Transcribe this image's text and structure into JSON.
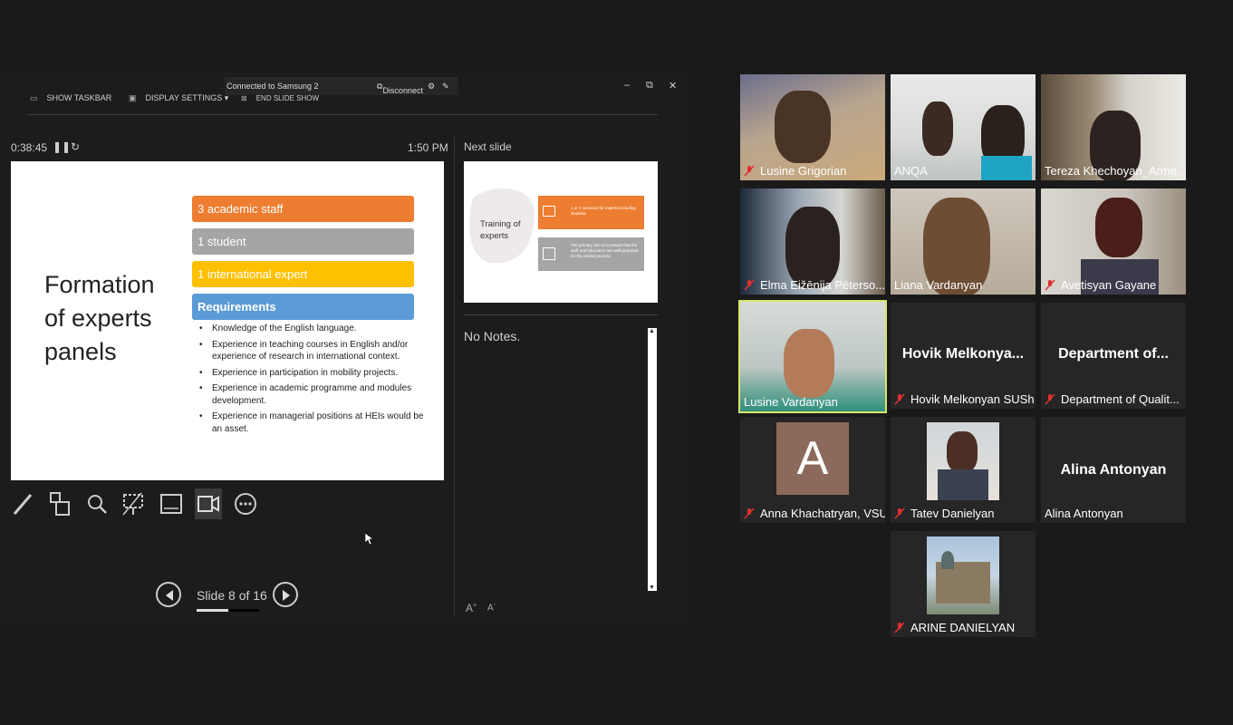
{
  "remote_bar": {
    "status": "Connected to Samsung 2",
    "disconnect": "Disconnect"
  },
  "taskbar": {
    "show_taskbar": "SHOW TASKBAR",
    "display_settings": "DISPLAY SETTINGS ▾",
    "end_show": "END SLIDE SHOW"
  },
  "timer": {
    "elapsed": "0:38:45",
    "clock": "1:50 PM"
  },
  "next_slide_label": "Next slide",
  "slide": {
    "title_lines": [
      "Formation",
      "of experts",
      "panels"
    ],
    "bars": [
      "3 academic staff",
      "1 student",
      "1 international expert",
      "Requirements"
    ],
    "requirements": [
      "Knowledge of the English language.",
      "Experience in teaching courses in English and/or experience of research in international context.",
      "Experience in participation in mobility projects.",
      "Experience in academic programme and modules development.",
      "Experience in managerial positions at HEIs would be an asset."
    ],
    "colors": {
      "orange": "#ed7d31",
      "gray": "#a5a5a5",
      "yellow": "#ffc000",
      "blue": "#5b9bd5"
    }
  },
  "next_slide": {
    "title": "Training of experts",
    "box1": "1 or 2 sessions for experts including students",
    "box2": "The primary aim is to ensure that the staff and educators are well-prepared for the review process"
  },
  "notes": "No Notes.",
  "nav": {
    "slide_counter": "Slide 8 of 16",
    "progress": 0.5
  },
  "tools": [
    "pen-icon",
    "grid-icon",
    "zoom-icon",
    "pointer-screen-icon",
    "subtitle-icon",
    "camera-icon",
    "more-icon"
  ],
  "participants": [
    {
      "name": "Lusine Grigorian",
      "muted": true
    },
    {
      "name": "ANQA",
      "muted": false
    },
    {
      "name": "Tereza Khechoyan_Arme...",
      "muted": false
    },
    {
      "name": "Elma Eižēnija Pēterso...",
      "muted": true
    },
    {
      "name": "Liana Vardanyan",
      "muted": false
    },
    {
      "name": "Avetisyan Gayane",
      "muted": true
    },
    {
      "name": "Lusine Vardanyan",
      "muted": false,
      "active_speaker": true
    },
    {
      "name": "Hovik Melkonyan SUSh",
      "muted": true,
      "display": "Hovik  Melkonya..."
    },
    {
      "name": "Department of Qualit...",
      "muted": true,
      "display": "Department  of..."
    },
    {
      "name": "Anna Khachatryan, VSU",
      "muted": true,
      "avatar_letter": "A"
    },
    {
      "name": "Tatev Danielyan",
      "muted": true
    },
    {
      "name": "Alina Antonyan",
      "muted": false,
      "display": "Alina Antonyan"
    },
    {
      "name": "ARINE DANIELYAN",
      "muted": true
    }
  ],
  "colors": {
    "active_speaker_border": "#d8e36a",
    "mic_muted": "#e03030"
  }
}
